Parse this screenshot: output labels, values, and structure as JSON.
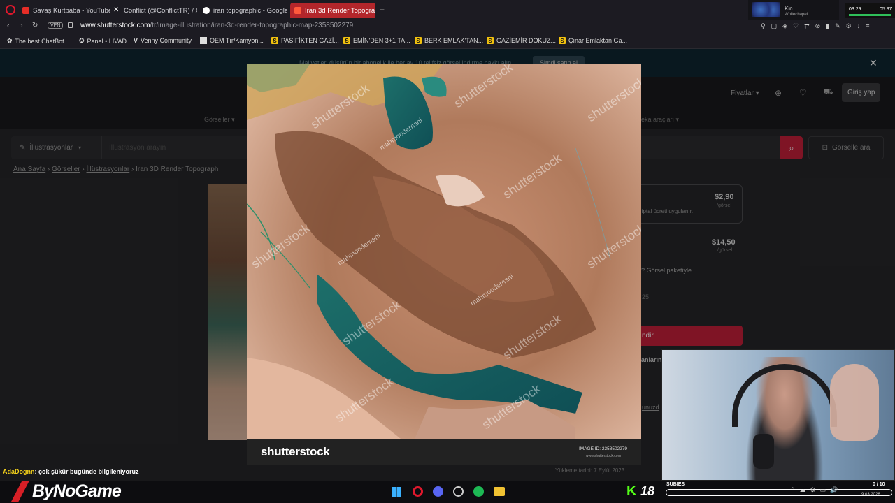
{
  "tabs": [
    {
      "label": "Savaş Kurtbaba - YouTube",
      "color": "#e52d27"
    },
    {
      "label": "Conflict (@ConflictTR) / X",
      "color": "#ffffff"
    },
    {
      "label": "iran topographic - Google",
      "color": "#4285f4"
    },
    {
      "label": "Iran 3d Render Topograph",
      "color": "#ffffff"
    }
  ],
  "address": {
    "vpn": "VPN",
    "url_host": "www.shutterstock.com",
    "url_path": "/tr/image-illustration/iran-3d-render-topographic-map-2358502279"
  },
  "bookmarks": [
    {
      "label": "The best ChatBot..."
    },
    {
      "label": "Panel • LIVAD"
    },
    {
      "label": "Venny Community"
    },
    {
      "label": "OEM Tır/Kamyon..."
    },
    {
      "label": "PASİFİKTEN GAZİ..."
    },
    {
      "label": "EMİN'DEN 3+1 TA..."
    },
    {
      "label": "BERK EMLAK'TAN..."
    },
    {
      "label": "GAZİEMİR DOKUZ..."
    },
    {
      "label": "Çınar Emlaktan Ga..."
    }
  ],
  "stream_top": {
    "name": "Kin",
    "sub": "Whitechapel",
    "time_left": "03:29",
    "time_right": "05:37"
  },
  "banner": {
    "text": "Maliyetleri düşürün bir abonelik ile her ay 10 telifsiz görsel indirme hakkı alın",
    "cta": "Şimdi satın al"
  },
  "header": {
    "pricing": "Fiyatlar",
    "login": "Giriş yap",
    "nav_images": "Görseller",
    "nav_ai": "Yapay zeka araçları"
  },
  "search": {
    "category": "İllüstrasyonlar",
    "placeholder": "İllüstrasyon arayın",
    "image_search": "Görselle ara"
  },
  "breadcrumb": [
    "Ana Sayfa",
    "Görseller",
    "İllüstrasyonlar",
    "Iran 3D Render Topograph"
  ],
  "pricing": {
    "price1": "$2,90",
    "unit1": "/görsel",
    "note1": "n iptal ücreti uygulanır.",
    "price2": "$14,50",
    "unit2": "/görsel",
    "pack": "? Görsel paketiyle",
    "qty": "25",
    "buy": "ndir",
    "fragment1": "anların",
    "fragment2": "unuzd"
  },
  "modal": {
    "brand": "shutterstock",
    "image_id": "IMAGE ID: 2358502279",
    "site": "www.shutterstock.com",
    "watermark": "shutterstock",
    "author": "mahmoodemani"
  },
  "upload_date": "Yükleme tarihi: 7 Eylül 2023",
  "chat": {
    "user": "AdaDognn",
    "message": ": çok şükür bugünde bilgileniyoruz"
  },
  "taskbar": {
    "brand": "ByNoGame",
    "kick_count": "18",
    "subies": "SUBIES",
    "sub_count": "0 / 10",
    "date": "9.03.2026"
  }
}
